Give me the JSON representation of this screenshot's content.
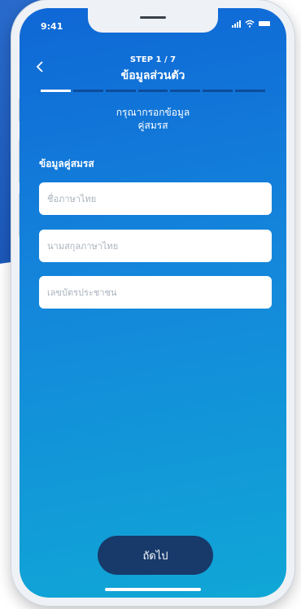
{
  "status": {
    "time": "9:41"
  },
  "header": {
    "step": "STEP 1 / 7",
    "title": "ข้อมูลส่วนตัว",
    "back_icon": "chevron-left-icon",
    "progress_total": 7,
    "progress_current": 1
  },
  "instruction": {
    "line1": "กรุณากรอกข้อมูล",
    "line2": "คู่สมรส"
  },
  "form": {
    "section_title": "ข้อมูลคู่สมรส",
    "fields": [
      {
        "placeholder": "ชื่อภาษาไทย",
        "value": ""
      },
      {
        "placeholder": "นามสกุลภาษาไทย",
        "value": ""
      },
      {
        "placeholder": "เลขบัตรประชาชน",
        "value": ""
      }
    ]
  },
  "footer": {
    "next_label": "ถัดไป"
  },
  "colors": {
    "accent": "#1486db",
    "button": "#173a6b"
  }
}
